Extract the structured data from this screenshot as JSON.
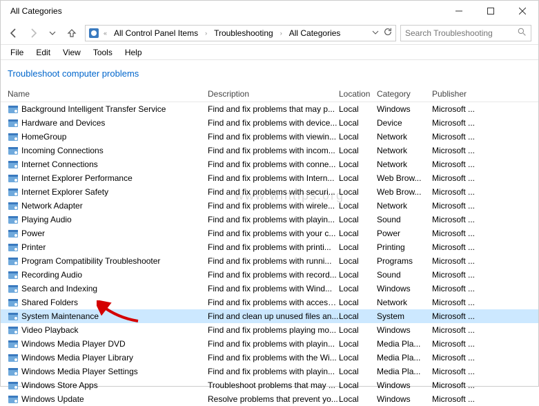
{
  "window": {
    "title": "All Categories"
  },
  "breadcrumb": {
    "root": "All Control Panel Items",
    "path1": "Troubleshooting",
    "path2": "All Categories"
  },
  "search": {
    "placeholder": "Search Troubleshooting"
  },
  "menu": {
    "file": "File",
    "edit": "Edit",
    "view": "View",
    "tools": "Tools",
    "help": "Help"
  },
  "page": {
    "title": "Troubleshoot computer problems"
  },
  "columns": {
    "name": "Name",
    "description": "Description",
    "location": "Location",
    "category": "Category",
    "publisher": "Publisher"
  },
  "items": [
    {
      "name": "Background Intelligent Transfer Service",
      "desc": "Find and fix problems that may p...",
      "loc": "Local",
      "cat": "Windows",
      "pub": "Microsoft ..."
    },
    {
      "name": "Hardware and Devices",
      "desc": "Find and fix problems with device...",
      "loc": "Local",
      "cat": "Device",
      "pub": "Microsoft ..."
    },
    {
      "name": "HomeGroup",
      "desc": "Find and fix problems with viewin...",
      "loc": "Local",
      "cat": "Network",
      "pub": "Microsoft ..."
    },
    {
      "name": "Incoming Connections",
      "desc": "Find and fix problems with incom...",
      "loc": "Local",
      "cat": "Network",
      "pub": "Microsoft ..."
    },
    {
      "name": "Internet Connections",
      "desc": "Find and fix problems with conne...",
      "loc": "Local",
      "cat": "Network",
      "pub": "Microsoft ..."
    },
    {
      "name": "Internet Explorer Performance",
      "desc": "Find and fix problems with Intern...",
      "loc": "Local",
      "cat": "Web Brow...",
      "pub": "Microsoft ..."
    },
    {
      "name": "Internet Explorer Safety",
      "desc": "Find and fix problems with securi...",
      "loc": "Local",
      "cat": "Web Brow...",
      "pub": "Microsoft ..."
    },
    {
      "name": "Network Adapter",
      "desc": "Find and fix problems with wirele...",
      "loc": "Local",
      "cat": "Network",
      "pub": "Microsoft ..."
    },
    {
      "name": "Playing Audio",
      "desc": "Find and fix problems with playin...",
      "loc": "Local",
      "cat": "Sound",
      "pub": "Microsoft ..."
    },
    {
      "name": "Power",
      "desc": "Find and fix problems with your c...",
      "loc": "Local",
      "cat": "Power",
      "pub": "Microsoft ..."
    },
    {
      "name": "Printer",
      "desc": "Find and fix problems with printi...",
      "loc": "Local",
      "cat": "Printing",
      "pub": "Microsoft ..."
    },
    {
      "name": "Program Compatibility Troubleshooter",
      "desc": "Find and fix problems with runni...",
      "loc": "Local",
      "cat": "Programs",
      "pub": "Microsoft ..."
    },
    {
      "name": "Recording Audio",
      "desc": "Find and fix problems with record...",
      "loc": "Local",
      "cat": "Sound",
      "pub": "Microsoft ..."
    },
    {
      "name": "Search and Indexing",
      "desc": "Find and fix problems with Wind...",
      "loc": "Local",
      "cat": "Windows",
      "pub": "Microsoft ..."
    },
    {
      "name": "Shared Folders",
      "desc": "Find and fix problems with access...",
      "loc": "Local",
      "cat": "Network",
      "pub": "Microsoft ..."
    },
    {
      "name": "System Maintenance",
      "desc": "Find and clean up unused files an...",
      "loc": "Local",
      "cat": "System",
      "pub": "Microsoft ...",
      "selected": true
    },
    {
      "name": "Video Playback",
      "desc": "Find and fix problems playing mo...",
      "loc": "Local",
      "cat": "Windows",
      "pub": "Microsoft ..."
    },
    {
      "name": "Windows Media Player DVD",
      "desc": "Find and fix problems with playin...",
      "loc": "Local",
      "cat": "Media Pla...",
      "pub": "Microsoft ..."
    },
    {
      "name": "Windows Media Player Library",
      "desc": "Find and fix problems with the Wi...",
      "loc": "Local",
      "cat": "Media Pla...",
      "pub": "Microsoft ..."
    },
    {
      "name": "Windows Media Player Settings",
      "desc": "Find and fix problems with playin...",
      "loc": "Local",
      "cat": "Media Pla...",
      "pub": "Microsoft ..."
    },
    {
      "name": "Windows Store Apps",
      "desc": "Troubleshoot problems that may ...",
      "loc": "Local",
      "cat": "Windows",
      "pub": "Microsoft ..."
    },
    {
      "name": "Windows Update",
      "desc": "Resolve problems that prevent yo...",
      "loc": "Local",
      "cat": "Windows",
      "pub": "Microsoft ..."
    }
  ],
  "watermark": "www.wintips.org"
}
